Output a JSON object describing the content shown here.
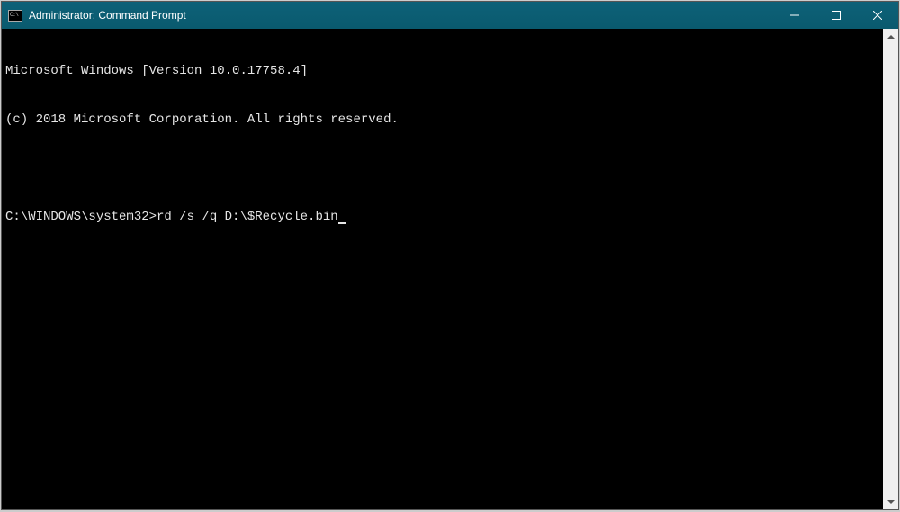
{
  "window": {
    "title": "Administrator: Command Prompt"
  },
  "terminal": {
    "line1": "Microsoft Windows [Version 10.0.17758.4]",
    "line2": "(c) 2018 Microsoft Corporation. All rights reserved.",
    "prompt": "C:\\WINDOWS\\system32>",
    "command": "rd /s /q D:\\$Recycle.bin"
  }
}
